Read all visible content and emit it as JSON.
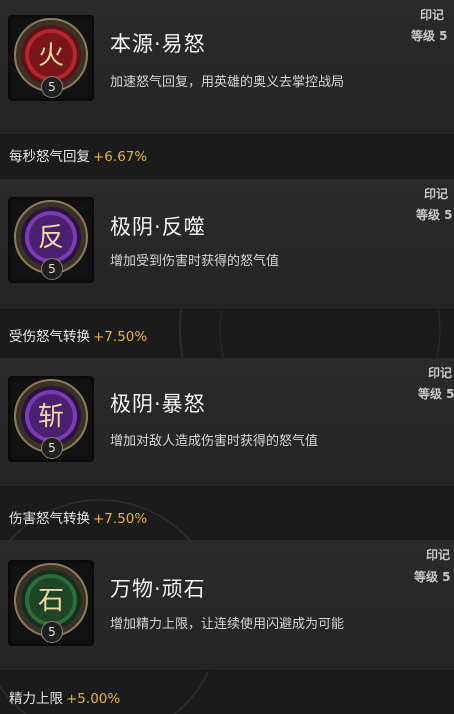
{
  "colors": {
    "background": "#1b1b1c",
    "stat_value": "#e8b33c",
    "icon_red": "#b5262f",
    "icon_purple": "#7b3bb3",
    "icon_green": "#2f6a3c"
  },
  "imprints": [
    {
      "icon": "fire-rune-icon",
      "glyph": "火",
      "level": "5",
      "title": "本源·易怒",
      "desc": "加速怒气回复，用英雄的奥义去掌控战局",
      "mark_label": "印记",
      "level_label": "等级 5",
      "stat_name": "每秒怒气回复",
      "stat_value": "+6.67%"
    },
    {
      "icon": "yin-rune-icon",
      "glyph": "反",
      "level": "5",
      "title": "极阴·反噬",
      "desc": "增加受到伤害时获得的怒气值",
      "mark_label": "印记",
      "level_label": "等级 5",
      "stat_name": "受伤怒气转换",
      "stat_value": "+7.50%"
    },
    {
      "icon": "yin-rage-rune-icon",
      "glyph": "斩",
      "level": "5",
      "title": "极阴·暴怒",
      "desc": "增加对敌人造成伤害时获得的怒气值",
      "mark_label": "印记",
      "level_label": "等级 5",
      "stat_name": "伤害怒气转换",
      "stat_value": "+7.50%"
    },
    {
      "icon": "stone-rune-icon",
      "glyph": "石",
      "level": "5",
      "title": "万物·顽石",
      "desc": "增加精力上限，让连续使用闪避成为可能",
      "mark_label": "印记",
      "level_label": "等级 5",
      "stat_name": "精力上限",
      "stat_value": "+5.00%"
    }
  ]
}
